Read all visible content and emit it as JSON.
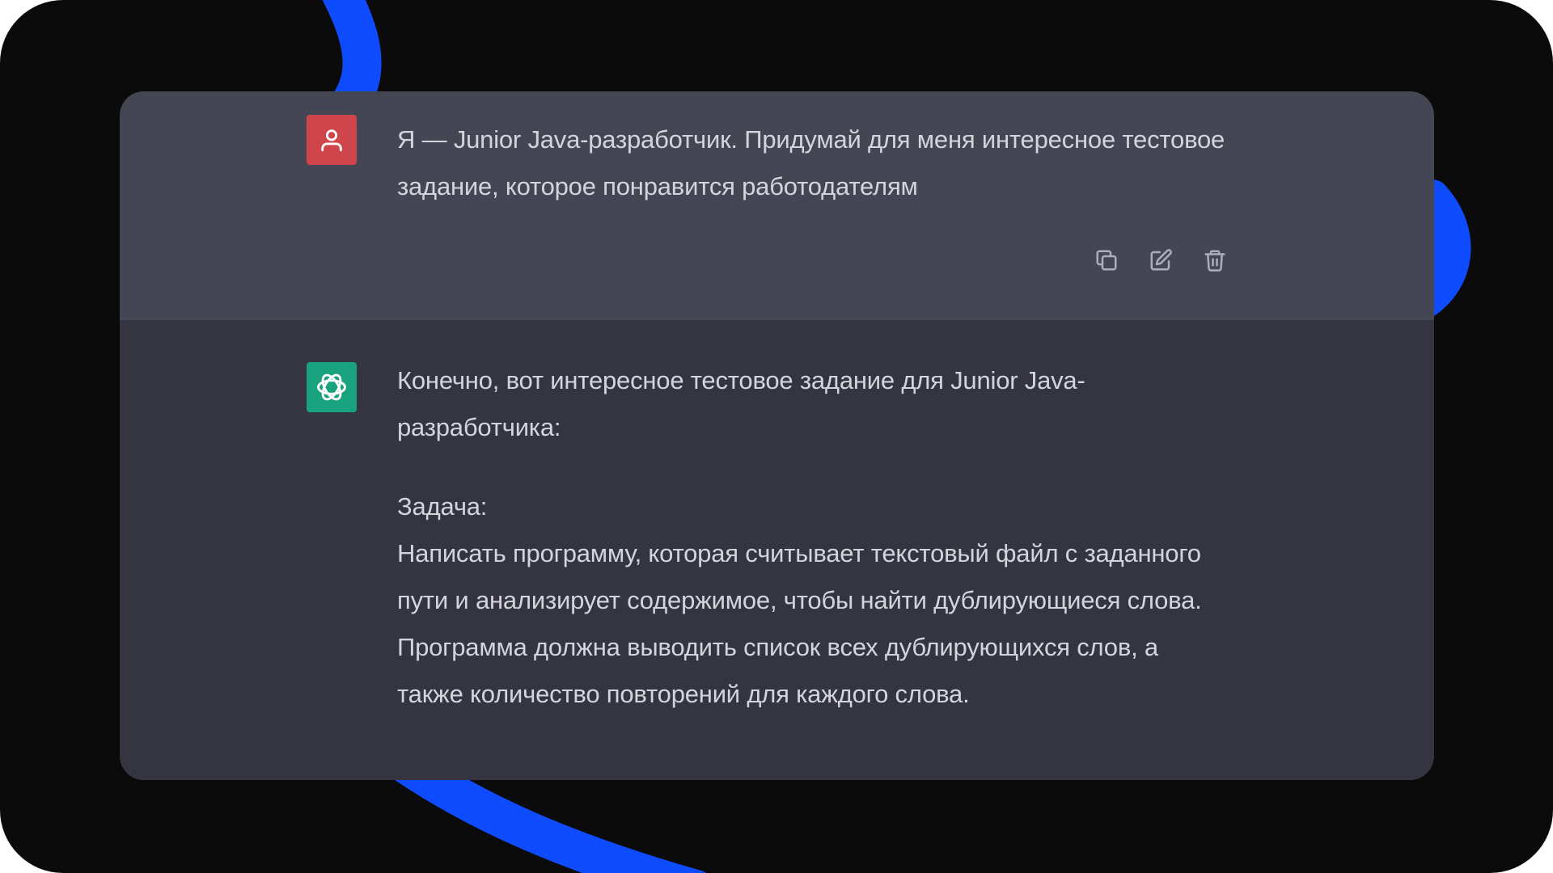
{
  "user_message": {
    "text": "Я — Junior Java-разработчик. Придумай для меня интересное тестовое задание, которое понравится работодателям",
    "avatar_icon": "user-icon",
    "avatar_color": "#d0454b"
  },
  "message_actions": [
    {
      "icon": "copy-icon"
    },
    {
      "icon": "edit-icon"
    },
    {
      "icon": "trash-icon"
    }
  ],
  "assistant_message": {
    "avatar_icon": "openai-logo-icon",
    "avatar_color": "#19a27e",
    "intro": "Конечно, вот интересное тестовое задание для Junior Java-разработчика:",
    "task_label": "Задача:",
    "task_text": "Написать программу, которая считывает текстовый файл с заданного пути и анализирует содержимое, чтобы найти дублирующиеся слова. Программа должна выводить список всех дублирующихся слов, а также количество повторений для каждого слова."
  },
  "colors": {
    "background": "#0b0b0c",
    "accent_swoosh": "#0f4cff",
    "user_bg": "#444654",
    "assistant_bg": "#343541",
    "text": "#d4d4db",
    "icon": "#acacbe"
  }
}
